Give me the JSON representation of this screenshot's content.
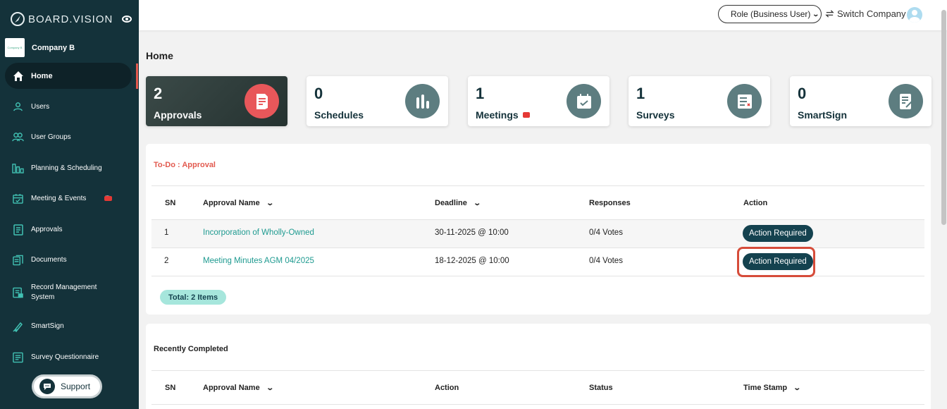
{
  "brand": {
    "name": "BOARD.VISION"
  },
  "company": {
    "name": "Company B",
    "logo_text": "Company B"
  },
  "sidebar": {
    "items": [
      {
        "label": "Home",
        "icon": "home-icon"
      },
      {
        "label": "Users",
        "icon": "user-icon"
      },
      {
        "label": "User Groups",
        "icon": "users-icon"
      },
      {
        "label": "Planning & Scheduling",
        "icon": "bars-icon"
      },
      {
        "label": "Meeting & Events",
        "icon": "calendar-icon"
      },
      {
        "label": "Approvals",
        "icon": "document-icon"
      },
      {
        "label": "Documents",
        "icon": "documents-icon"
      },
      {
        "label": "Record Management System",
        "icon": "record-icon"
      },
      {
        "label": "SmartSign",
        "icon": "pen-icon"
      },
      {
        "label": "Survey Questionnaire",
        "icon": "survey-icon"
      }
    ],
    "support_label": "Support"
  },
  "header": {
    "role_label": "Role (Business User)",
    "switch_label": "Switch Company"
  },
  "page": {
    "title": "Home"
  },
  "cards": [
    {
      "count": "2",
      "label": "Approvals"
    },
    {
      "count": "0",
      "label": "Schedules"
    },
    {
      "count": "1",
      "label": "Meetings"
    },
    {
      "count": "1",
      "label": "Surveys"
    },
    {
      "count": "0",
      "label": "SmartSign"
    }
  ],
  "todo": {
    "title": "To-Do : Approval",
    "columns": [
      "SN",
      "Approval Name",
      "Deadline",
      "Responses",
      "Action"
    ],
    "rows": [
      {
        "sn": "1",
        "name": "Incorporation of Wholly-Owned",
        "deadline": "30-11-2025 @ 10:00",
        "responses": "0/4 Votes",
        "action": "Action Required"
      },
      {
        "sn": "2",
        "name": "Meeting Minutes AGM 04/2025",
        "deadline": "18-12-2025 @ 10:00",
        "responses": "0/4 Votes",
        "action": "Action Required"
      }
    ],
    "total": "Total: 2 Items"
  },
  "completed": {
    "title": "Recently Completed",
    "columns": [
      "SN",
      "Approval Name",
      "Action",
      "Status",
      "Time Stamp"
    ]
  },
  "colors": {
    "sidebar": "#14323a",
    "accent": "#1e9a90",
    "todo_title": "#e25a4f",
    "highlight": "#d64c3a"
  }
}
